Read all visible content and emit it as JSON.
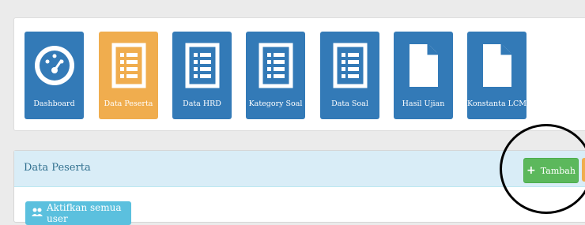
{
  "tiles": [
    {
      "label": "Dashboard",
      "icon": "dashboard-gauge-icon",
      "active": false
    },
    {
      "label": "Data Peserta",
      "icon": "list-document-icon",
      "active": true
    },
    {
      "label": "Data HRD",
      "icon": "list-document-icon",
      "active": false
    },
    {
      "label": "Kategory Soal",
      "icon": "list-document-icon",
      "active": false
    },
    {
      "label": "Data Soal",
      "icon": "list-document-icon",
      "active": false
    },
    {
      "label": "Hasil Ujian",
      "icon": "blank-file-icon",
      "active": false
    },
    {
      "label": "Konstanta LCM",
      "icon": "blank-file-icon",
      "active": false
    }
  ],
  "panel": {
    "title": "Data Peserta",
    "add_label": "Tambah",
    "activate_label": "Aktifkan semua user"
  },
  "colors": {
    "tile": "#337ab7",
    "tile_active": "#f0ad4e",
    "add_button": "#5cb85c",
    "activate_button": "#5bc0de",
    "panel_heading": "#d9edf7"
  }
}
